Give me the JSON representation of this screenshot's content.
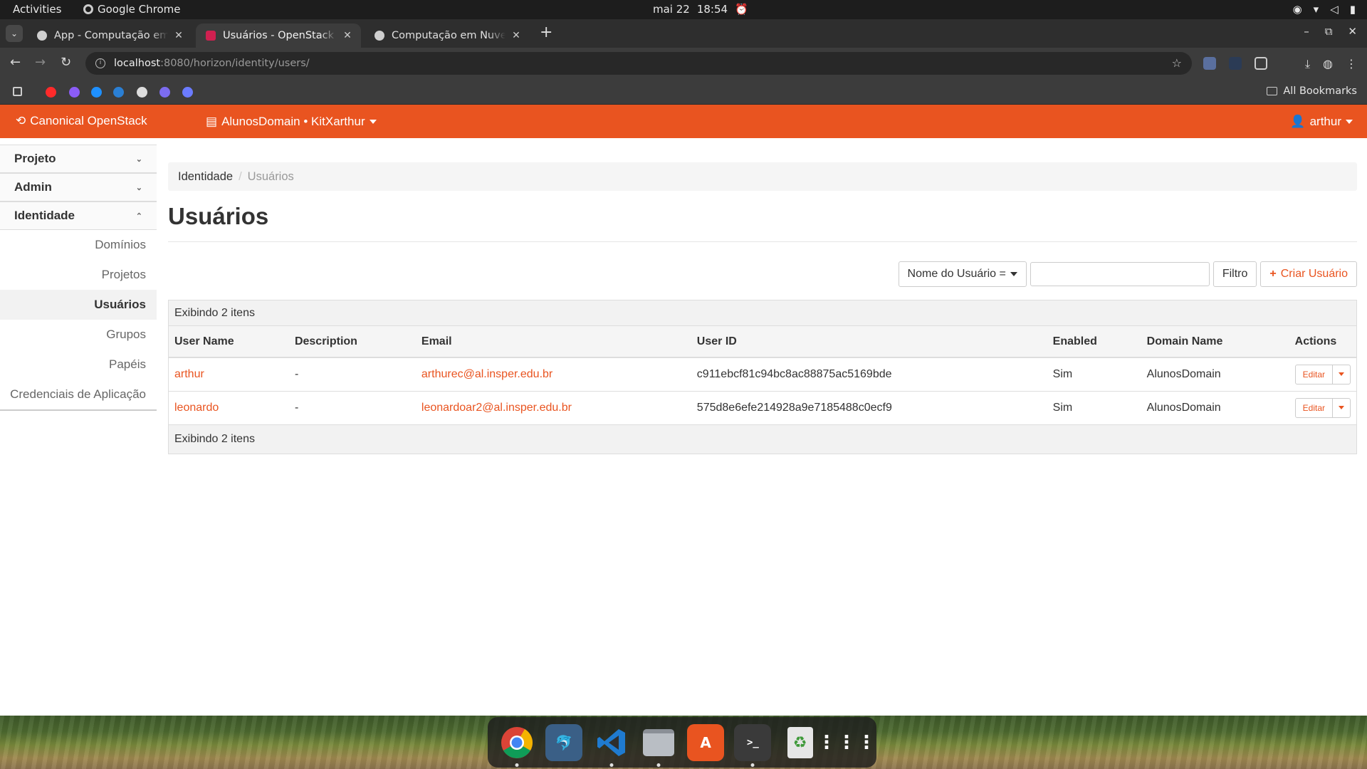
{
  "system": {
    "activities": "Activities",
    "app_name": "Google Chrome",
    "date": "mai 22",
    "time": "18:54"
  },
  "browser": {
    "tabs": [
      {
        "title": "App - Computação em N",
        "favicon_color": "#cfcfcf",
        "active": false
      },
      {
        "title": "Usuários - OpenStack Da",
        "favicon_color": "#d02050",
        "active": true
      },
      {
        "title": "Computação em Nuvem",
        "favicon_color": "#cfcfcf",
        "active": false
      }
    ],
    "url_host": "localhost",
    "url_path": ":8080/horizon/identity/users/",
    "all_bookmarks": "All Bookmarks",
    "bookmark_colors": [
      "#ff2a2a",
      "#8b5cf6",
      "#1e90ff",
      "#2a7fd4",
      "#dddddd",
      "#7c6cf0",
      "#6b7bff"
    ]
  },
  "navbar": {
    "brand": "Canonical OpenStack",
    "project": "AlunosDomain • KitXarthur",
    "user": "arthur",
    "color": "#e95420"
  },
  "sidebar": {
    "sections": [
      {
        "label": "Projeto",
        "icon": "chevron-down-icon"
      },
      {
        "label": "Admin",
        "icon": "chevron-down-icon"
      },
      {
        "label": "Identidade",
        "icon": "chevron-up-icon"
      }
    ],
    "items": [
      {
        "label": "Domínios",
        "active": false
      },
      {
        "label": "Projetos",
        "active": false
      },
      {
        "label": "Usuários",
        "active": true
      },
      {
        "label": "Grupos",
        "active": false
      },
      {
        "label": "Papéis",
        "active": false
      },
      {
        "label": "Credenciais de Aplicação",
        "active": false
      }
    ]
  },
  "page": {
    "breadcrumb": [
      "Identidade",
      "Usuários"
    ],
    "title": "Usuários",
    "filter_select": "Nome do Usuário =",
    "filter_input_value": "",
    "filter_button": "Filtro",
    "create_button": "Criar Usuário",
    "count_text": "Exibindo 2 itens",
    "footer_text": "Exibindo 2 itens"
  },
  "table": {
    "columns": [
      "User Name",
      "Description",
      "Email",
      "User ID",
      "Enabled",
      "Domain Name",
      "Actions"
    ],
    "rows": [
      {
        "name": "arthur",
        "description": "-",
        "email": "arthurec@al.insper.edu.br",
        "id": "c911ebcf81c94bc8ac88875ac5169bde",
        "enabled": "Sim",
        "domain": "AlunosDomain",
        "action": "Editar"
      },
      {
        "name": "leonardo",
        "description": "-",
        "email": "leonardoar2@al.insper.edu.br",
        "id": "575d8e6efe214928a9e7185488c0ecf9",
        "enabled": "Sim",
        "domain": "AlunosDomain",
        "action": "Editar"
      }
    ]
  },
  "dock": {
    "apps": [
      {
        "name": "chrome",
        "color": "#db4437",
        "running": true
      },
      {
        "name": "mysql-workbench",
        "color": "#3a5f86",
        "running": false
      },
      {
        "name": "vscode",
        "color": "#1f7bd0",
        "running": true
      },
      {
        "name": "files",
        "color": "#8a8f96",
        "running": true
      },
      {
        "name": "app-center",
        "color": "#e95420",
        "running": false
      },
      {
        "name": "terminal",
        "color": "#3a3a3a",
        "running": true
      },
      {
        "name": "trash",
        "color": "#5a8f52",
        "running": false
      },
      {
        "name": "show-apps",
        "color": "transparent",
        "running": false
      }
    ]
  }
}
